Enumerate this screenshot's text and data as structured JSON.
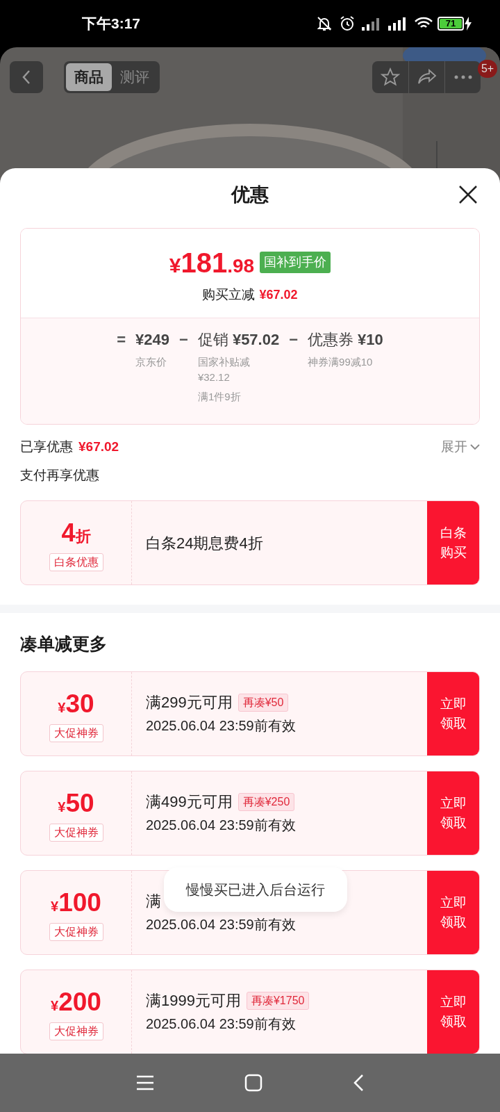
{
  "status_bar": {
    "time": "下午3:17",
    "battery": "71"
  },
  "header": {
    "tabs": [
      {
        "label": "商品",
        "selected": true
      },
      {
        "label": "测评",
        "selected": false
      }
    ],
    "badge": "5+"
  },
  "sheet": {
    "title": "优惠",
    "price_card": {
      "currency": "¥",
      "price_integer": "181",
      "price_decimal": ".98",
      "price_tag": "国补到手价",
      "saving_label": "购买立减",
      "saving_amount": "¥67.02",
      "breakdown": [
        {
          "operator": "=",
          "value": "¥249",
          "notes": [
            "京东价"
          ]
        },
        {
          "operator": "−",
          "label": "促销",
          "value": "¥57.02",
          "notes": [
            "国家补贴减¥32.12",
            "满1件9折"
          ]
        },
        {
          "operator": "−",
          "label": "优惠券",
          "value": "¥10",
          "notes": [
            "神券满99减10"
          ]
        }
      ]
    },
    "enjoyed": {
      "label": "已享优惠",
      "amount": "¥67.02",
      "expand": "展开"
    },
    "pay_section": {
      "title": "支付再享优惠",
      "offer": {
        "value": "4",
        "unit": "折",
        "tag": "白条优惠",
        "description": "白条24期息费4折",
        "button": "白条购买"
      }
    },
    "coupon_section": {
      "title": "凑单减更多",
      "coupons": [
        {
          "currency": "¥",
          "amount": "30",
          "tag": "大促神券",
          "condition": "满299元可用",
          "extra": "再凑¥50",
          "validity": "2025.06.04 23:59前有效",
          "button": "立即领取"
        },
        {
          "currency": "¥",
          "amount": "50",
          "tag": "大促神券",
          "condition": "满499元可用",
          "extra": "再凑¥250",
          "validity": "2025.06.04 23:59前有效",
          "button": "立即领取"
        },
        {
          "currency": "¥",
          "amount": "100",
          "tag": "大促神券",
          "condition": "满",
          "validity": "2025.06.04 23:59前有效",
          "button": "立即领取"
        },
        {
          "currency": "¥",
          "amount": "200",
          "tag": "大促神券",
          "condition": "满1999元可用",
          "extra": "再凑¥1750",
          "validity": "2025.06.04 23:59前有效",
          "button": "立即领取"
        }
      ]
    }
  },
  "toast": "慢慢买已进入后台运行"
}
